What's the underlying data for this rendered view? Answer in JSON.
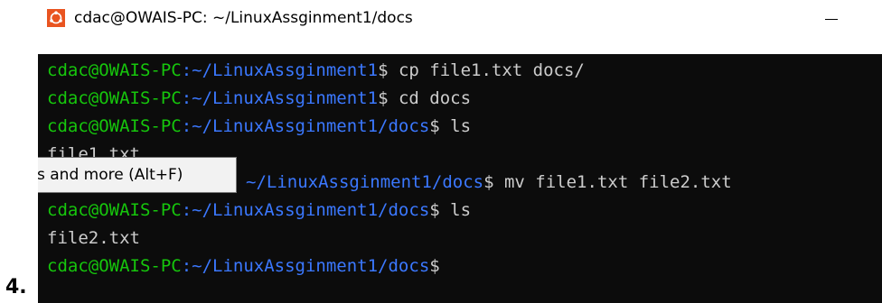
{
  "list_number": "4.",
  "window": {
    "title": "cdac@OWAIS-PC: ~/LinuxAssginment1/docs",
    "icon": "ubuntu-app-icon",
    "minimize_icon": "minimize-icon"
  },
  "colors": {
    "terminal_bg": "#0c0c0c",
    "prompt_user": "#16c60c",
    "prompt_path": "#3b78ff",
    "text": "#cccccc"
  },
  "terminal": {
    "lines": [
      {
        "user": "cdac@OWAIS-PC",
        "path": ":~/LinuxAssginment1",
        "text": "$ cp file1.txt docs/"
      },
      {
        "user": "cdac@OWAIS-PC",
        "path": ":~/LinuxAssginment1",
        "text": "$ cd docs"
      },
      {
        "user": "cdac@OWAIS-PC",
        "path": ":~/LinuxAssginment1/docs",
        "text": "$ ls"
      },
      {
        "output": "file1.txt"
      },
      {
        "path": "~/LinuxAssginment1/docs",
        "text": "$ mv file1.txt file2.txt"
      },
      {
        "user": "cdac@OWAIS-PC",
        "path": ":~/LinuxAssginment1/docs",
        "text": "$ ls"
      },
      {
        "output": "file2.txt"
      },
      {
        "user": "cdac@OWAIS-PC",
        "path": ":~/LinuxAssginment1/docs",
        "text": "$"
      }
    ]
  },
  "tooltip": {
    "text": "s and more (Alt+F)"
  }
}
